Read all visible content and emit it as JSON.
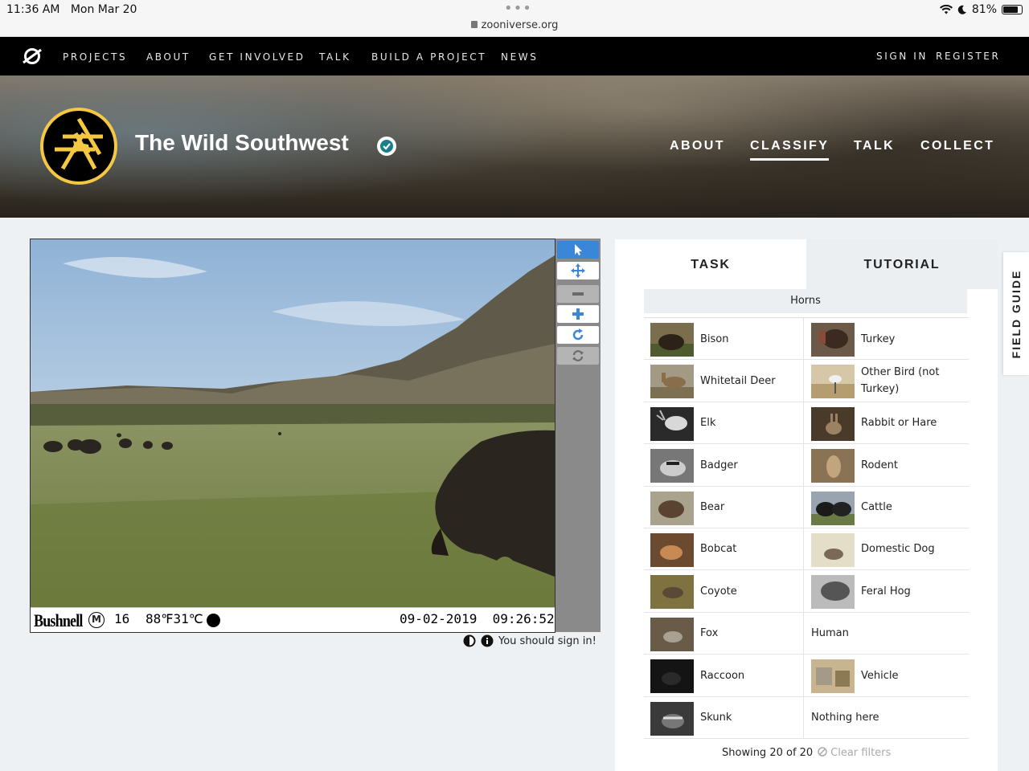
{
  "statusbar": {
    "time": "11:36 AM",
    "date": "Mon Mar 20",
    "url": "zooniverse.org",
    "battery": "81%"
  },
  "topnav": {
    "items": [
      "PROJECTS",
      "ABOUT",
      "GET INVOLVED",
      "TALK",
      "BUILD A PROJECT",
      "NEWS"
    ],
    "sign_in": "SIGN IN",
    "register": "REGISTER"
  },
  "project": {
    "title": "The Wild Southwest",
    "nav": [
      "ABOUT",
      "CLASSIFY",
      "TALK",
      "COLLECT"
    ],
    "active_nav": "CLASSIFY",
    "accent": "#f4c842"
  },
  "subject": {
    "brand": "Bushnell",
    "m_badge": "M",
    "frame": "16",
    "temperature": "88℉31℃",
    "datetime": "09-02-2019  09:26:52"
  },
  "toolbar": {
    "tools": [
      "pointer-icon",
      "move-icon",
      "zoom-out-icon",
      "zoom-in-icon",
      "rotate-icon",
      "reset-icon"
    ],
    "active_color": "#3a87d9"
  },
  "viewer_footer": {
    "message": "You should sign in!"
  },
  "task_panel": {
    "tab_task": "TASK",
    "tab_tutorial": "TUTORIAL",
    "filter_label": "Horns",
    "choices": [
      [
        "Bison",
        "Turkey"
      ],
      [
        "Whitetail Deer",
        "Other Bird (not Turkey)"
      ],
      [
        "Elk",
        "Rabbit or Hare"
      ],
      [
        "Badger",
        "Rodent"
      ],
      [
        "Bear",
        "Cattle"
      ],
      [
        "Bobcat",
        "Domestic Dog"
      ],
      [
        "Coyote",
        "Feral Hog"
      ],
      [
        "Fox",
        "Human"
      ],
      [
        "Raccoon",
        "Vehicle"
      ],
      [
        "Skunk",
        "Nothing here"
      ]
    ],
    "showing": "Showing 20 of 20",
    "clear_filters": "Clear filters"
  },
  "field_guide": {
    "label": "FIELD GUIDE"
  }
}
